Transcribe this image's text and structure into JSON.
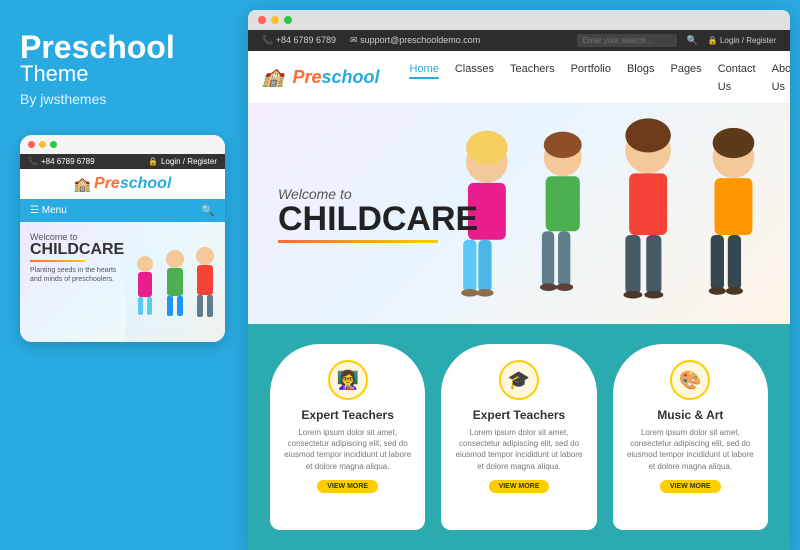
{
  "left": {
    "title": "Preschool",
    "subtitle": "Theme",
    "by": "By jwsthemes"
  },
  "mobile": {
    "phone": "+84 6789 6789",
    "login": "Login / Register",
    "logo_pre": "Pre",
    "logo_school": "school",
    "menu_label": "☰  Menu",
    "welcome": "Welcome to",
    "childcare": "CHILDCARE",
    "tagline": "Planting seeds in the hearts and minds of preschoolers."
  },
  "desktop": {
    "topbar_phone": "📞 +84 6789 6789",
    "topbar_email": "✉ support@preschooldemo.com",
    "search_placeholder": "Enter your search...",
    "login": "🔒 Login / Register",
    "logo_pre": "Pre",
    "logo_school": "school",
    "nav_items": [
      "Home",
      "Classes",
      "Teachers",
      "Portfolio",
      "Blogs",
      "Pages",
      "Contact Us",
      "About Us"
    ],
    "hero_welcome": "Welcome to",
    "hero_childcare": "CHILDCARE",
    "features": [
      {
        "icon": "👩‍🏫",
        "title": "Expert Teachers",
        "text": "Lorem ipsum dolor sit amet, consectetur adipiscing elit, sed do eiusmod tempor incididunt ut labore et dolore magna aliqua.",
        "btn": "VIEW MORE"
      },
      {
        "icon": "🎓",
        "title": "Expert Teachers",
        "text": "Lorem ipsum dolor sit amet, consectetur adipiscing elit, sed do eiusmod tempor incididunt ut labore et dolore magna aliqua.",
        "btn": "VIEW MORE"
      },
      {
        "icon": "🎨",
        "title": "Music & Art",
        "text": "Lorem ipsum dolor sit amet, consectetur adipiscing elit, sed do eiusmod tempor incididunt ut labore et dolore magna aliqua.",
        "btn": "VIEW MORE"
      }
    ]
  },
  "colors": {
    "brand_blue": "#29abe2",
    "brand_orange": "#ff6b35",
    "brand_yellow": "#ffcc00",
    "teal": "#2baab0"
  }
}
